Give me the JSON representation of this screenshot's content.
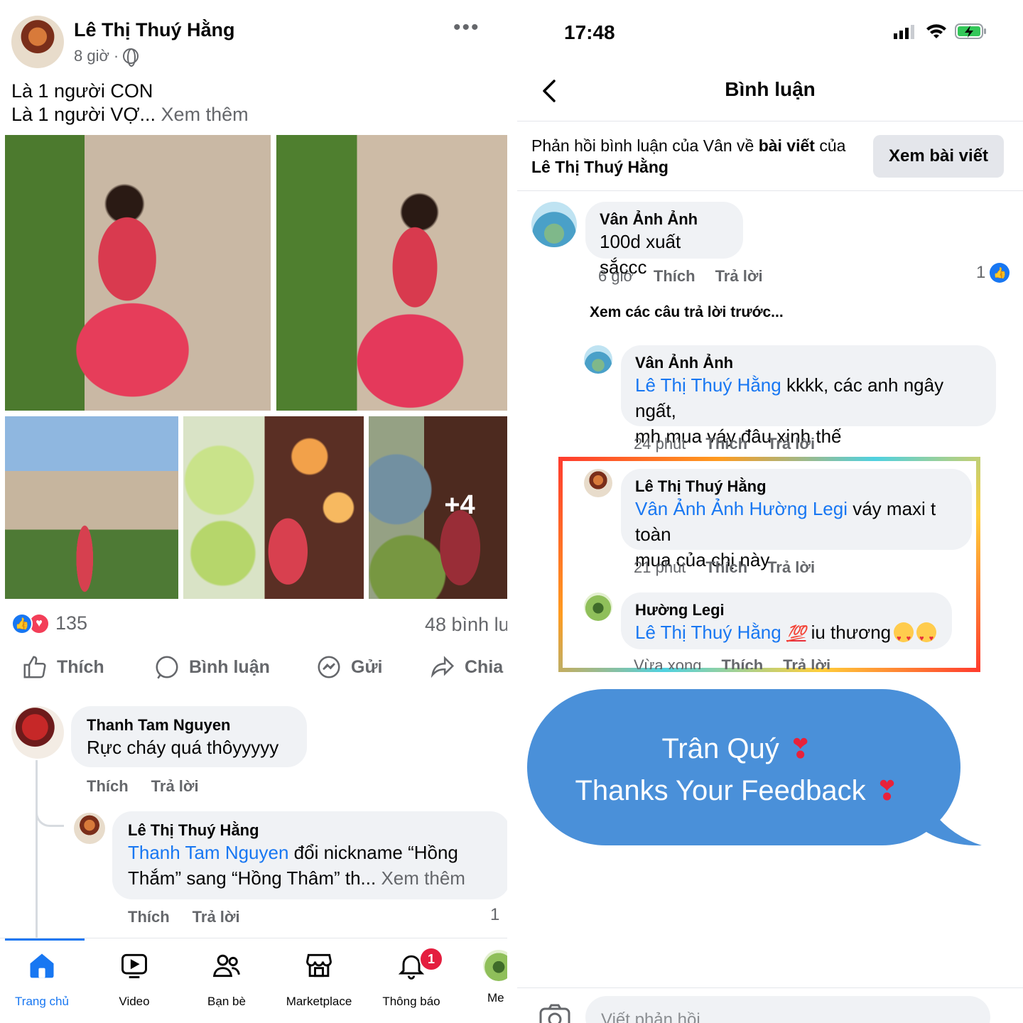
{
  "post": {
    "author": "Lê Thị Thuý Hằng",
    "time": "8 giờ",
    "separator": "·",
    "line1": "Là 1 người CON",
    "line2": "Là 1 người VỢ...",
    "see_more": "Xem thêm",
    "more_photos": "+4",
    "reaction_count": "135",
    "comment_count": "48 bình lu",
    "actions": {
      "like": "Thích",
      "comment": "Bình luận",
      "send": "Gửi",
      "share": "Chia s"
    }
  },
  "post_comments": [
    {
      "name": "Thanh Tam Nguyen",
      "text": "Rực cháy quá thôyyyyy",
      "like": "Thích",
      "reply": "Trả lời"
    },
    {
      "name": "Lê Thị Thuý Hằng",
      "mention": "Thanh Tam Nguyen",
      "text1": " đổi nickname “Hồng",
      "text2": "Thắm” sang “Hồng Thâm” th...",
      "see_more": "Xem thêm",
      "like": "Thích",
      "reply": "Trả lời",
      "count": "1"
    }
  ],
  "tabbar": [
    {
      "label": "Trang chủ",
      "icon": "home-icon"
    },
    {
      "label": "Video",
      "icon": "video-icon"
    },
    {
      "label": "Bạn bè",
      "icon": "friends-icon"
    },
    {
      "label": "Marketplace",
      "icon": "marketplace-icon"
    },
    {
      "label": "Thông báo",
      "icon": "bell-icon",
      "badge": "1"
    },
    {
      "label": "Me",
      "icon": "profile-avatar"
    }
  ],
  "status_bar": {
    "time": "17:48"
  },
  "comments_screen": {
    "title": "Bình luận",
    "reply_info_1": "Phản hồi bình luận của Vân về ",
    "reply_info_bold": "bài viết",
    "reply_info_2": " của",
    "reply_info_author": "Lê Thị Thuý Hằng",
    "view_post": "Xem bài viết",
    "see_previous": "Xem các câu trả lời trước...",
    "input_placeholder": "Viết phản hồi..."
  },
  "comments": [
    {
      "name": "Vân Ảnh Ảnh",
      "text": "100d xuất sắccc",
      "time": "6 giờ",
      "like": "Thích",
      "reply": "Trả lời",
      "likes": "1"
    },
    {
      "name": "Vân Ảnh Ảnh",
      "mention": "Lê Thị Thuý Hằng",
      "text1": " kkkk, các anh ngây ngất,",
      "text2": "mh mua váy đâu xinh thế",
      "time": "24 phút",
      "like": "Thích",
      "reply": "Trả lời"
    },
    {
      "name": "Lê Thị Thuý Hằng",
      "mention": "Vân Ảnh Ảnh Hường Legi",
      "text1": " váy maxi t toàn",
      "text2": "mua của chị này",
      "time": "21 phút",
      "like": "Thích",
      "reply": "Trả lời"
    },
    {
      "name": "Hường Legi",
      "mention": "Lê Thị Thuý Hằng",
      "emoji": "💯",
      "text1": " iu thương",
      "time": "Vừa xong",
      "like": "Thích",
      "reply": "Trả lời"
    }
  ],
  "overlay": {
    "line1": "Trân Quý",
    "line2": "Thanks Your Feedback",
    "heart": "❣"
  },
  "colors": {
    "facebook_blue": "#1877f2",
    "bubble_gray": "#f0f2f5",
    "speech_blue": "#4a90d9",
    "badge_red": "#e41e3f"
  }
}
